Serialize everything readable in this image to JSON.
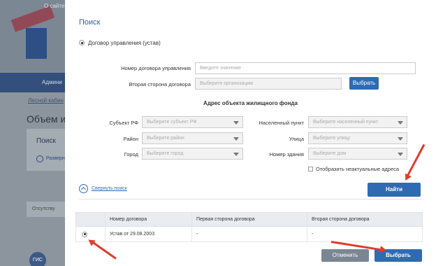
{
  "background": {
    "site_text": "О сайте",
    "nav_item": "Админи",
    "link": "Лесной кабин",
    "title": "Объем и",
    "panel_title": "Поиск",
    "panel_link": "Разверн",
    "strip_text": "Отсутству",
    "footer_logo": "ГИС"
  },
  "modal": {
    "title": "Поиск",
    "radio_contract": "Договор управления (устав)",
    "contract_number_label": "Номер договора управления",
    "contract_number_placeholder": "Введите значение",
    "second_party_label": "Вторая сторона договора",
    "second_party_placeholder": "Выберите организацию",
    "choose_button": "Выбрать",
    "address_section_title": "Адрес объекта жилищного фонда",
    "fields": {
      "subject_label": "Субъект РФ",
      "subject_placeholder": "Выберите субъект РФ",
      "district_label": "Район",
      "district_placeholder": "Выберите район",
      "city_label": "Город",
      "city_placeholder": "Выберите город",
      "locality_label": "Населенный пункт",
      "locality_placeholder": "Выберите населенный пункт",
      "street_label": "Улица",
      "street_placeholder": "Выберите улицу",
      "building_label": "Номер здания",
      "building_placeholder": "Выберите дом"
    },
    "show_irrelevant_label": "Отобразить неактуальные адреса",
    "find_button": "Найти",
    "collapse_link": "Свернуть поиск",
    "table": {
      "headers": [
        "",
        "Номер договора",
        "Первая сторона договора",
        "Вторая сторона договора"
      ],
      "rows": [
        {
          "number": "Устав от 29.08.2003",
          "first_party": "-",
          "second_party": "-"
        }
      ]
    },
    "cancel_button": "Отменить",
    "select_button": "Выбрать"
  },
  "colors": {
    "accent": "#2f6bb4",
    "arrow": "#e03c2c"
  }
}
